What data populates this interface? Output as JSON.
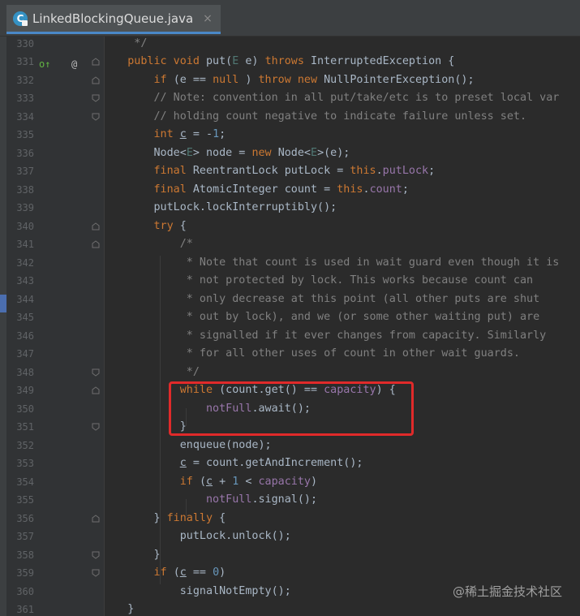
{
  "tab": {
    "icon": "C",
    "label": "LinkedBlockingQueue.java",
    "close": "×"
  },
  "lines": [
    {
      "n": "330",
      "t": [
        [
          "cm",
          "     */"
        ]
      ]
    },
    {
      "n": "331",
      "t": [
        [
          "",
          "    "
        ],
        [
          "kw",
          "public void "
        ],
        [
          "",
          "put("
        ],
        [
          "tp",
          "E"
        ],
        [
          "",
          " e) "
        ],
        [
          "kw",
          "throws "
        ],
        [
          "",
          "InterruptedException {"
        ]
      ]
    },
    {
      "n": "332",
      "t": [
        [
          "",
          "        "
        ],
        [
          "kw",
          "if "
        ],
        [
          "",
          "(e == "
        ],
        [
          "kw",
          "null"
        ],
        [
          "",
          " ) "
        ],
        [
          "kw",
          "throw new "
        ],
        [
          "",
          "NullPointerException();"
        ]
      ]
    },
    {
      "n": "333",
      "t": [
        [
          "cm",
          "        // Note: convention in all put/take/etc is to preset local var"
        ]
      ]
    },
    {
      "n": "334",
      "t": [
        [
          "cm",
          "        // holding count negative to indicate failure unless set."
        ]
      ]
    },
    {
      "n": "335",
      "t": [
        [
          "",
          "        "
        ],
        [
          "kw",
          "int "
        ],
        [
          "ul",
          "c"
        ],
        [
          "",
          " = -"
        ],
        [
          "num",
          "1"
        ],
        [
          "",
          ";"
        ]
      ]
    },
    {
      "n": "336",
      "t": [
        [
          "",
          "        Node<"
        ],
        [
          "tp",
          "E"
        ],
        [
          "",
          "> node = "
        ],
        [
          "kw",
          "new "
        ],
        [
          "",
          "Node<"
        ],
        [
          "tp",
          "E"
        ],
        [
          "",
          ">(e);"
        ]
      ]
    },
    {
      "n": "337",
      "t": [
        [
          "",
          "        "
        ],
        [
          "kw",
          "final "
        ],
        [
          "",
          "ReentrantLock putLock = "
        ],
        [
          "kw",
          "this"
        ],
        [
          "",
          "."
        ],
        [
          "fld",
          "putLock"
        ],
        [
          "",
          ";"
        ]
      ]
    },
    {
      "n": "338",
      "t": [
        [
          "",
          "        "
        ],
        [
          "kw",
          "final "
        ],
        [
          "",
          "AtomicInteger count = "
        ],
        [
          "kw",
          "this"
        ],
        [
          "",
          "."
        ],
        [
          "fld",
          "count"
        ],
        [
          "",
          ";"
        ]
      ]
    },
    {
      "n": "339",
      "t": [
        [
          "",
          "        putLock.lockInterruptibly();"
        ]
      ]
    },
    {
      "n": "340",
      "t": [
        [
          "",
          "        "
        ],
        [
          "kw",
          "try "
        ],
        [
          "",
          "{"
        ]
      ]
    },
    {
      "n": "341",
      "t": [
        [
          "cm",
          "            /*"
        ]
      ]
    },
    {
      "n": "342",
      "t": [
        [
          "cm",
          "             * Note that count is used in wait guard even though it is"
        ]
      ]
    },
    {
      "n": "343",
      "t": [
        [
          "cm",
          "             * not protected by lock. This works because count can"
        ]
      ]
    },
    {
      "n": "344",
      "t": [
        [
          "cm",
          "             * only decrease at this point (all other puts are shut"
        ]
      ]
    },
    {
      "n": "345",
      "t": [
        [
          "cm",
          "             * out by lock), and we (or some other waiting put) are"
        ]
      ]
    },
    {
      "n": "346",
      "t": [
        [
          "cm",
          "             * signalled if it ever changes from capacity. Similarly"
        ]
      ]
    },
    {
      "n": "347",
      "t": [
        [
          "cm",
          "             * for all other uses of count in other wait guards."
        ]
      ]
    },
    {
      "n": "348",
      "t": [
        [
          "cm",
          "             */"
        ]
      ]
    },
    {
      "n": "349",
      "t": [
        [
          "",
          "            "
        ],
        [
          "kw",
          "while "
        ],
        [
          "",
          "(count.get() == "
        ],
        [
          "fld",
          "capacity"
        ],
        [
          "",
          ") {"
        ]
      ]
    },
    {
      "n": "350",
      "t": [
        [
          "",
          "                "
        ],
        [
          "fld",
          "notFull"
        ],
        [
          "",
          ".await();"
        ]
      ]
    },
    {
      "n": "351",
      "t": [
        [
          "",
          "            }"
        ]
      ]
    },
    {
      "n": "352",
      "t": [
        [
          "",
          "            enqueue(node);"
        ]
      ]
    },
    {
      "n": "353",
      "t": [
        [
          "",
          "            "
        ],
        [
          "ul",
          "c"
        ],
        [
          "",
          " = count.getAndIncrement();"
        ]
      ]
    },
    {
      "n": "354",
      "t": [
        [
          "",
          "            "
        ],
        [
          "kw",
          "if "
        ],
        [
          "",
          "("
        ],
        [
          "ul",
          "c"
        ],
        [
          "",
          " + "
        ],
        [
          "num",
          "1"
        ],
        [
          "",
          " < "
        ],
        [
          "fld",
          "capacity"
        ],
        [
          "",
          ")"
        ]
      ]
    },
    {
      "n": "355",
      "t": [
        [
          "",
          "                "
        ],
        [
          "fld",
          "notFull"
        ],
        [
          "",
          ".signal();"
        ]
      ]
    },
    {
      "n": "356",
      "t": [
        [
          "",
          "        } "
        ],
        [
          "kw",
          "finally "
        ],
        [
          "",
          "{"
        ]
      ]
    },
    {
      "n": "357",
      "t": [
        [
          "",
          "            putLock.unlock();"
        ]
      ]
    },
    {
      "n": "358",
      "t": [
        [
          "",
          "        }"
        ]
      ]
    },
    {
      "n": "359",
      "t": [
        [
          "",
          "        "
        ],
        [
          "kw",
          "if "
        ],
        [
          "",
          "("
        ],
        [
          "ul",
          "c"
        ],
        [
          "",
          " == "
        ],
        [
          "num",
          "0"
        ],
        [
          "",
          ")"
        ]
      ]
    },
    {
      "n": "360",
      "t": [
        [
          "",
          "            signalNotEmpty();"
        ]
      ]
    },
    {
      "n": "361",
      "t": [
        [
          "",
          "    }"
        ]
      ]
    }
  ],
  "gutter_icons": {
    "override": "o↑",
    "annotation": "@"
  },
  "watermark": "@稀土掘金技术社区",
  "colors": {
    "keyword": "#cc7832",
    "comment": "#808080",
    "number": "#6897bb",
    "field": "#9876aa",
    "type_param": "#507874",
    "text": "#a9b7c6",
    "highlight_box": "#e02a2a"
  }
}
